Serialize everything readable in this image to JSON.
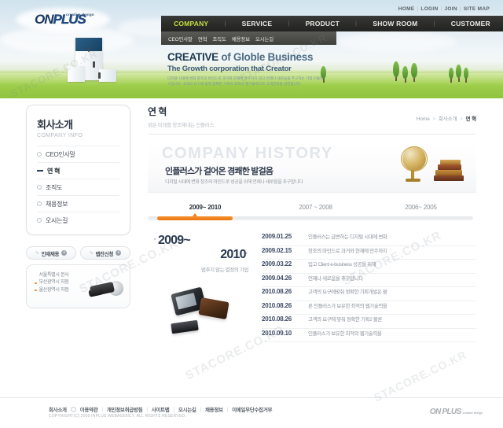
{
  "site": {
    "logo_main": "ON PLUS",
    "logo_on": "ON",
    "logo_plus": "PLUS",
    "logo_tagline": "creative design"
  },
  "utility": {
    "links": [
      "HOME",
      "LOGIN",
      "JOIN",
      "SITE MAP"
    ]
  },
  "gnb": {
    "items": [
      {
        "label": "COMPANY",
        "active": true
      },
      {
        "label": "SERVICE",
        "active": false
      },
      {
        "label": "PRODUCT",
        "active": false
      },
      {
        "label": "SHOW ROOM",
        "active": false
      },
      {
        "label": "CUSTOMER",
        "active": false
      }
    ],
    "separator": "|"
  },
  "lnb": {
    "items": [
      "CEO인사말",
      "연혁",
      "조직도",
      "채용정보",
      "오시는길"
    ]
  },
  "hero": {
    "title_bold": "CREATIVE",
    "title_rest": "of Globle Business",
    "subtitle": "The Growth corporation that Creator",
    "description": "디지털 시대에 변화 창조의 마인드로 과거와 현재에 안주하지 않고 언제나 새로움을 추구하는 기업 인플러스입니다. 고객의 요구에 맞춰 정확한 기획과 최적의 웹기술력으로 고객만족을 실현합니다."
  },
  "sidebar": {
    "title": "회사소개",
    "subtitle": "COMPANY INFO",
    "items": [
      {
        "label": "CEO인사말",
        "active": false
      },
      {
        "label": "연 혁",
        "active": true
      },
      {
        "label": "조직도",
        "active": false
      },
      {
        "label": "채용정보",
        "active": false
      },
      {
        "label": "오시는길",
        "active": false
      }
    ],
    "buttons": [
      {
        "label": "인재채용",
        "arrow": "+"
      },
      {
        "label": "맵잔신청",
        "arrow": "+"
      }
    ],
    "offices": [
      {
        "name": "서울특별시  본사"
      },
      {
        "name": "부산광역시  지점"
      },
      {
        "name": "울산광역시  지점"
      }
    ]
  },
  "page": {
    "title": "연 혁",
    "subtitle": "밝은 미래를 창조해내는 인플러스",
    "breadcrumb": {
      "home": "Home",
      "mid": "회사소개",
      "current": "연 혁",
      "sep": ">"
    }
  },
  "history_banner": {
    "watermark": "COMPANY HISTORY",
    "headline": "인플러스가 걸어온 경쾌한 발걸음",
    "description": "디지털 시대에 변화 창조의 마인드로 성공을 위해 언제나 새로움을 추구합니다"
  },
  "tabs": [
    {
      "label": "2009~ 2010",
      "active": true
    },
    {
      "label": "2007 ~ 2008",
      "active": false
    },
    {
      "label": "2006~ 2005",
      "active": false
    }
  ],
  "year_block": {
    "quote_open": "'",
    "quote_close": "'",
    "line1": "2009~",
    "line2": "2010",
    "caption": "멈추지 않는 열정의 기업"
  },
  "history_list": [
    {
      "date": "2009.01.25",
      "text": "인플러스는 급변하는 디지털 시대에 변화"
    },
    {
      "date": "2009.02.15",
      "text": "창조의 마인드로 과거와 현재에 안주하지"
    },
    {
      "date": "2009.03.22",
      "text": "입고 Client e-business 성공을 위해"
    },
    {
      "date": "2009.04.26",
      "text": "언제나 새로움을 추구합니다"
    },
    {
      "date": "2010.08.26",
      "text": "고객의 요구에맞춰 정확한 기획개발은 물"
    },
    {
      "date": "2010.08.26",
      "text": "론 인플러스가 보유한 최적의 웹기술력을"
    },
    {
      "date": "2010.08.26",
      "text": "고객의 요구에 맞춰 정확한 기획2 물론"
    },
    {
      "date": "2010.09.10",
      "text": "인플러스가 보유한 최적의 웹기술력을"
    }
  ],
  "footer": {
    "links": [
      "회사소개",
      "이용약관",
      "개인정보취급방침",
      "사이트맵",
      "오시는길",
      "채용정보",
      "이메일무단수집거부"
    ],
    "separator": "|",
    "copyright": "COPYRIGHT(C) 2009 INPLUS WEBAGENCY. ALL RIGHTS RESERVED.",
    "logo": "ON PLUS",
    "logo_tag": "creative design"
  },
  "watermarks": [
    "STACORE.CO.KR",
    "STACORE.CO.KR",
    "STACORE.CO.KR",
    "STACORE.CO.KR",
    "STACORE.CO.KR",
    "STACORE.CO.KR"
  ],
  "colors": {
    "accent_orange": "#ef8422",
    "nav_active": "#c2e03c",
    "nav_bg": "#2b2b29",
    "brand_navy": "#16365c"
  }
}
